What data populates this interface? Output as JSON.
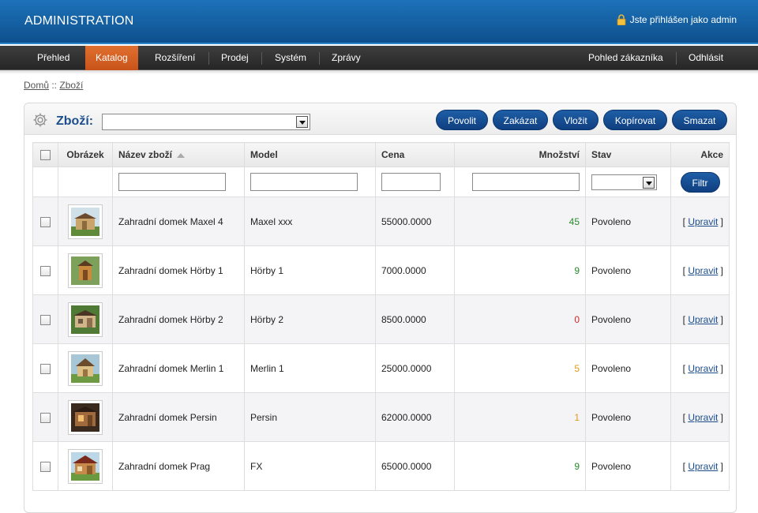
{
  "header": {
    "title": "ADMINISTRATION",
    "login_text": "Jste přihlášen jako admin"
  },
  "menu": {
    "left": [
      {
        "label": "Přehled",
        "active": false
      },
      {
        "label": "Katalog",
        "active": true
      },
      {
        "label": "Rozšíření",
        "active": false
      },
      {
        "label": "Prodej",
        "active": false
      },
      {
        "label": "Systém",
        "active": false
      },
      {
        "label": "Zprávy",
        "active": false
      }
    ],
    "right": [
      {
        "label": "Pohled zákazníka"
      },
      {
        "label": "Odhlásit"
      }
    ]
  },
  "breadcrumb": {
    "home": "Domů",
    "separator": " :: ",
    "current": "Zboží"
  },
  "panel": {
    "title": "Zboží:",
    "select_value": "",
    "buttons": {
      "enable": "Povolit",
      "disable": "Zakázat",
      "insert": "Vložit",
      "copy": "Kopírovat",
      "delete": "Smazat"
    }
  },
  "table": {
    "headers": {
      "image": "Obrázek",
      "name": "Název zboží",
      "model": "Model",
      "price": "Cena",
      "quantity": "Množství",
      "status": "Stav",
      "action": "Akce"
    },
    "filter_button": "Filtr",
    "rows": [
      {
        "name": "Zahradní domek Maxel 4",
        "model": "Maxel xxx",
        "price": "55000.0000",
        "quantity": "45",
        "status": "Povoleno",
        "edit": "Upravit",
        "q_color": "#2b8a2b"
      },
      {
        "name": "Zahradní domek Hörby 1",
        "model": "Hörby 1",
        "price": "7000.0000",
        "quantity": "9",
        "status": "Povoleno",
        "edit": "Upravit",
        "q_color": "#2b8a2b"
      },
      {
        "name": "Zahradní domek Hörby 2",
        "model": "Hörby 2",
        "price": "8500.0000",
        "quantity": "0",
        "status": "Povoleno",
        "edit": "Upravit",
        "q_color": "#d42424"
      },
      {
        "name": "Zahradní domek Merlin 1",
        "model": "Merlin 1",
        "price": "25000.0000",
        "quantity": "5",
        "status": "Povoleno",
        "edit": "Upravit",
        "q_color": "#e09a15"
      },
      {
        "name": "Zahradní domek Persin",
        "model": "Persin",
        "price": "62000.0000",
        "quantity": "1",
        "status": "Povoleno",
        "edit": "Upravit",
        "q_color": "#e09a15"
      },
      {
        "name": "Zahradní domek Prag",
        "model": "FX",
        "price": "65000.0000",
        "quantity": "9",
        "status": "Povoleno",
        "edit": "Upravit",
        "q_color": "#2b8a2b"
      }
    ]
  }
}
